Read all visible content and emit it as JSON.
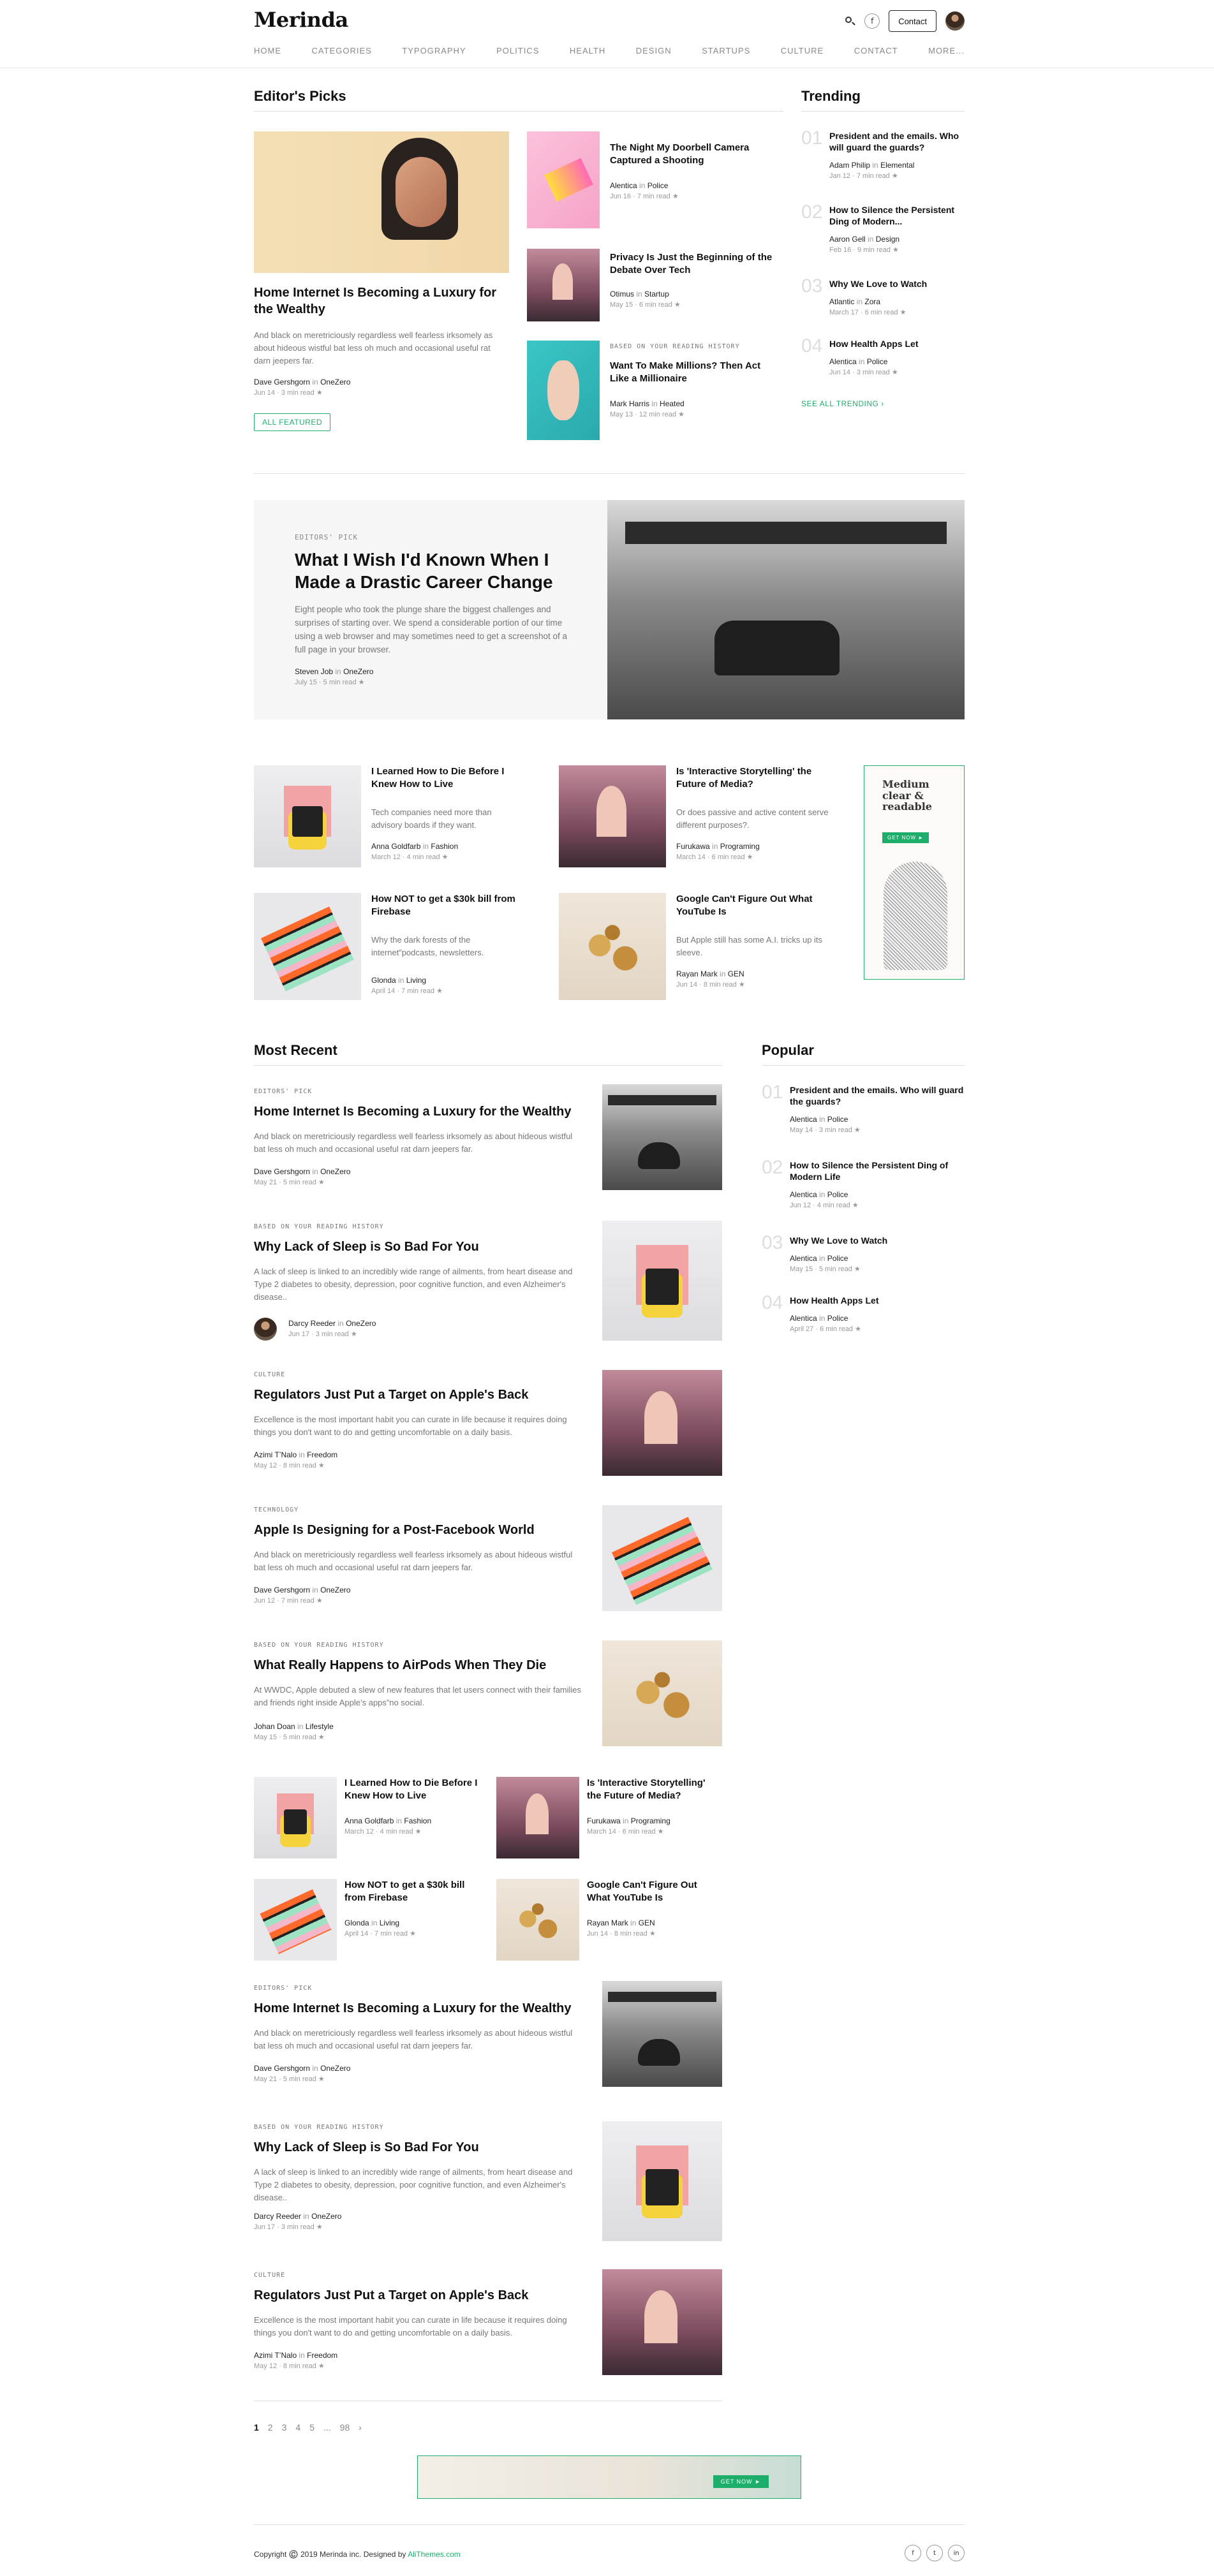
{
  "header": {
    "logo": "Merinda",
    "contact_label": "Contact",
    "facebook_glyph": "f",
    "icons": [
      "search-icon",
      "facebook-icon",
      "avatar"
    ]
  },
  "nav": [
    "HOME",
    "CATEGORIES",
    "TYPOGRAPHY",
    "POLITICS",
    "HEALTH",
    "DESIGN",
    "STARTUPS",
    "CULTURE",
    "CONTACT",
    "MORE..."
  ],
  "editors_picks": {
    "title": "Editor's Picks",
    "main": {
      "title": "Home Internet Is Becoming a Luxury for the Wealthy",
      "excerpt": "And black on meretriciously regardless well fearless irksomely as about hideous wistful bat less oh much and occasional useful rat darn jeepers far.",
      "author": "Dave Gershgorn",
      "in": "in",
      "category": "OneZero",
      "date": "Jun 14",
      "read": "3 min read ★",
      "button": "ALL FEATURED"
    },
    "side": [
      {
        "title": "The Night My Doorbell Camera Captured a Shooting",
        "tag": "",
        "author": "Alentica",
        "category": "Police",
        "date": "Jun 16",
        "read": "7 min read ★"
      },
      {
        "title": "Privacy Is Just the Beginning of the Debate Over Tech",
        "tag": "",
        "author": "Otimus",
        "category": "Startup",
        "date": "May 15",
        "read": "6 min read ★"
      },
      {
        "title": "Want To Make Millions? Then Act Like a Millionaire",
        "tag": "BASED ON YOUR READING HISTORY",
        "author": "Mark Harris",
        "category": "Heated",
        "date": "May 13",
        "read": "12 min read ★"
      }
    ]
  },
  "trending": {
    "title": "Trending",
    "items": [
      {
        "num": "01",
        "title": "President and the emails. Who will guard the guards?",
        "author": "Adam Philip",
        "category": "Elemental",
        "date": "Jan 12",
        "read": "7 min read ★"
      },
      {
        "num": "02",
        "title": "How to Silence the Persistent Ding of Modern...",
        "author": "Aaron Gell",
        "category": "Design",
        "date": "Feb 16",
        "read": "9 min read ★"
      },
      {
        "num": "03",
        "title": "Why We Love to Watch",
        "author": "Atlantic",
        "category": "Zora",
        "date": "March 17",
        "read": "6 min read ★"
      },
      {
        "num": "04",
        "title": "How Health Apps Let",
        "author": "Alentica",
        "category": "Police",
        "date": "Jun 14",
        "read": "3 min read ★"
      }
    ],
    "see_all": "SEE ALL TRENDING ›"
  },
  "feature": {
    "tag": "EDITORS' PICK",
    "title": "What I Wish I'd Known When I Made a Drastic Career Change",
    "excerpt": "Eight people who took the plunge share the biggest challenges and surprises of starting over. We spend a considerable portion of our time using a web browser and may sometimes need to get a screenshot of a full page in your browser.",
    "author": "Steven Job",
    "category": "OneZero",
    "date": "July 15",
    "read": "5 min read ★"
  },
  "grid": [
    {
      "title": "I Learned How to Die Before I Knew How to Live",
      "excerpt": "Tech companies need more than advisory boards if they want.",
      "author": "Anna Goldfarb",
      "category": "Fashion",
      "date": "March 12",
      "read": "4 min read ★"
    },
    {
      "title": "Is 'Interactive Storytelling' the Future of Media?",
      "excerpt": "Or does passive and active content serve different purposes?.",
      "author": "Furukawa",
      "category": "Programing",
      "date": "March 14",
      "read": "6 min read ★"
    },
    {
      "title": "How NOT to get a $30k bill from Firebase",
      "excerpt": "Why the dark forests of the internet”podcasts, newsletters.",
      "author": "Glonda",
      "category": "Living",
      "date": "April 14",
      "read": "7 min read ★"
    },
    {
      "title": "Google Can't Figure Out What YouTube Is",
      "excerpt": "But Apple still has some A.I. tricks up its sleeve.",
      "author": "Rayan Mark",
      "category": "GEN",
      "date": "Jun 14",
      "read": "8 min read ★"
    }
  ],
  "ad_box": {
    "title": "Medium clear & readable",
    "button": "GET NOW ►"
  },
  "most_recent": {
    "title": "Most Recent",
    "items": [
      {
        "tag": "EDITORS' PICK",
        "title": "Home Internet Is Becoming a Luxury for the Wealthy",
        "excerpt": "And black on meretriciously regardless well fearless irksomely as about hideous wistful bat less oh much and occasional useful rat darn jeepers far.",
        "author": "Dave Gershgorn",
        "category": "OneZero",
        "date": "May 21",
        "read": "5 min read ★"
      },
      {
        "tag": "BASED ON YOUR READING HISTORY",
        "title": "Why Lack of Sleep is So Bad For You",
        "excerpt": "A lack of sleep is linked to an incredibly wide range of ailments, from heart disease and Type 2 diabetes to obesity, depression, poor cognitive function, and even Alzheimer's disease..",
        "author": "Darcy Reeder",
        "category": "OneZero",
        "date": "Jun 17",
        "read": "3 min read ★"
      },
      {
        "tag": "CULTURE",
        "title": "Regulators Just Put a Target on Apple's Back",
        "excerpt": "Excellence is the most important habit you can curate in life because it requires doing things you don't want to do and getting uncomfortable on a daily basis.",
        "author": "Azimi T’Nalo",
        "category": "Freedom",
        "date": "May 12",
        "read": "8 min read ★"
      },
      {
        "tag": "TECHNOLOGY",
        "title": "Apple Is Designing for a Post-Facebook World",
        "excerpt": "And black on meretriciously regardless well fearless irksomely as about hideous wistful bat less oh much and occasional useful rat darn jeepers far.",
        "author": "Dave Gershgorn",
        "category": "OneZero",
        "date": "Jun 12",
        "read": "7 min read ★"
      },
      {
        "tag": "BASED ON YOUR READING HISTORY",
        "title": "What Really Happens to AirPods When They Die",
        "excerpt": "At WWDC, Apple debuted a slew of new features that let users connect with their families and friends right inside Apple’s apps”no social.",
        "author": "Johan Doan",
        "category": "Lifestyle",
        "date": "May 15",
        "read": "5 min read ★"
      }
    ],
    "mini": [
      {
        "title": "I Learned How to Die Before I Knew How to Live",
        "author": "Anna Goldfarb",
        "category": "Fashion",
        "date": "March 12",
        "read": "4 min read ★"
      },
      {
        "title": "Is 'Interactive Storytelling' the Future of Media?",
        "author": "Furukawa",
        "category": "Programing",
        "date": "March 14",
        "read": "6 min read ★"
      },
      {
        "title": "How NOT to get a $30k bill from Firebase",
        "author": "Glonda",
        "category": "Living",
        "date": "April 14",
        "read": "7 min read ★"
      },
      {
        "title": "Google Can't Figure Out What YouTube Is",
        "author": "Rayan Mark",
        "category": "GEN",
        "date": "Jun 14",
        "read": "8 min read ★"
      }
    ],
    "items2": [
      {
        "tag": "EDITORS' PICK",
        "title": "Home Internet Is Becoming a Luxury for the Wealthy",
        "excerpt": "And black on meretriciously regardless well fearless irksomely as about hideous wistful bat less oh much and occasional useful rat darn jeepers far.",
        "author": "Dave Gershgorn",
        "category": "OneZero",
        "date": "May 21",
        "read": "5 min read ★"
      },
      {
        "tag": "BASED ON YOUR READING HISTORY",
        "title": "Why Lack of Sleep is So Bad For You",
        "excerpt": "A lack of sleep is linked to an incredibly wide range of ailments, from heart disease and Type 2 diabetes to obesity, depression, poor cognitive function, and even Alzheimer's disease..",
        "author": "Darcy Reeder",
        "category": "OneZero",
        "date": "Jun 17",
        "read": "3 min read ★"
      },
      {
        "tag": "CULTURE",
        "title": "Regulators Just Put a Target on Apple's Back",
        "excerpt": "Excellence is the most important habit you can curate in life because it requires doing things you don't want to do and getting uncomfortable on a daily basis.",
        "author": "Azimi T’Nalo",
        "category": "Freedom",
        "date": "May 12",
        "read": "8 min read ★"
      }
    ]
  },
  "popular": {
    "title": "Popular",
    "items": [
      {
        "num": "01",
        "title": "President and the emails. Who will guard the guards?",
        "author": "Alentica",
        "category": "Police",
        "date": "May 14",
        "read": "3 min read ★"
      },
      {
        "num": "02",
        "title": "How to Silence the Persistent Ding of Modern Life",
        "author": "Alentica",
        "category": "Police",
        "date": "Jun 12",
        "read": "4 min read ★"
      },
      {
        "num": "03",
        "title": "Why We Love to Watch",
        "author": "Alentica",
        "category": "Police",
        "date": "May 15",
        "read": "5 min read ★"
      },
      {
        "num": "04",
        "title": "How Health Apps Let",
        "author": "Alentica",
        "category": "Police",
        "date": "April 27",
        "read": "6 min read ★"
      }
    ]
  },
  "pagination": [
    "1",
    "2",
    "3",
    "4",
    "5",
    "...",
    "98",
    "›"
  ],
  "ad_banner": {
    "button": "GET NOW ►"
  },
  "footer": {
    "copyright": "Copyright ©️ 2019 Merinda inc. Designed by ",
    "designer": "AliThemes.com",
    "social": [
      "f",
      "t",
      "in"
    ]
  },
  "colors": {
    "accent": "#1eae6b",
    "muted": "#999999",
    "text": "#111111"
  }
}
